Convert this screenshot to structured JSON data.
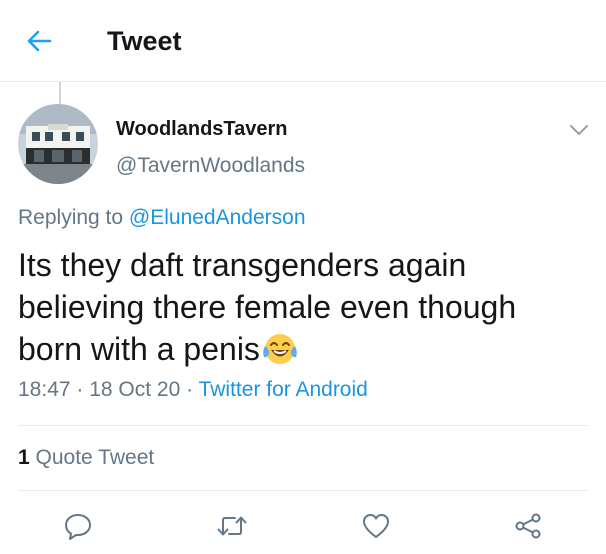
{
  "header": {
    "title": "Tweet",
    "back_icon": "arrow-left-icon"
  },
  "tweet": {
    "display_name": "WoodlandsTavern",
    "handle": "@TavernWoodlands",
    "replying_prefix": "Replying to ",
    "replying_to": "@ElunedAnderson",
    "text": "Its they daft transgenders again believing there female even though born with a penis",
    "emoji": "face-with-tears-of-joy-icon",
    "time": "18:47",
    "date": "18 Oct 20",
    "source": "Twitter for Android",
    "separator": " · "
  },
  "stats": {
    "quote_count": "1",
    "quote_label": " Quote Tweet"
  },
  "colors": {
    "accent": "#1b95e0",
    "text": "#14171a",
    "secondary": "#657786",
    "divider": "#e6ecf0"
  }
}
